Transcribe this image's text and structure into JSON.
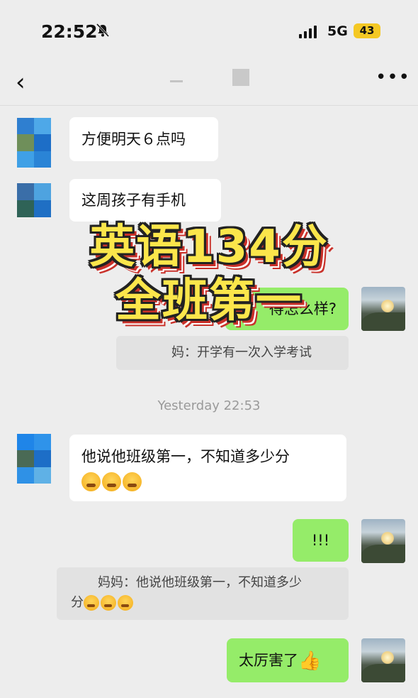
{
  "status": {
    "time": "22:52",
    "network": "5G",
    "battery": "43"
  },
  "nav": {
    "back": "‹",
    "more": "•••"
  },
  "messages": {
    "m1": "方便明天６点吗",
    "m2": "这周孩子有手机",
    "m3_partial": "得怎么样?",
    "quote1": "妈：开学有一次入学考试",
    "timestamp": "Yesterday 22:53",
    "m4": "他说他班级第一，不知道多少分",
    "m5": "!!!",
    "quote2_line1": "妈妈：他说他班级第一，不知道多少",
    "quote2_line2": "分",
    "m6": "太厉害了"
  },
  "overlay": {
    "line1": "英语134分",
    "line2": "全班第一"
  },
  "colors": {
    "bubble_green": "#95ec69",
    "bubble_white": "#ffffff",
    "background": "#ededed",
    "overlay_text": "#fbe64b",
    "overlay_shadow": "#c9312a"
  },
  "icons": {
    "mute": "bell-slash-icon",
    "back": "chevron-left-icon",
    "more": "more-dots-icon",
    "emoji": "grimacing-tears-emoji",
    "thumb": "thumbs-up-emoji"
  }
}
